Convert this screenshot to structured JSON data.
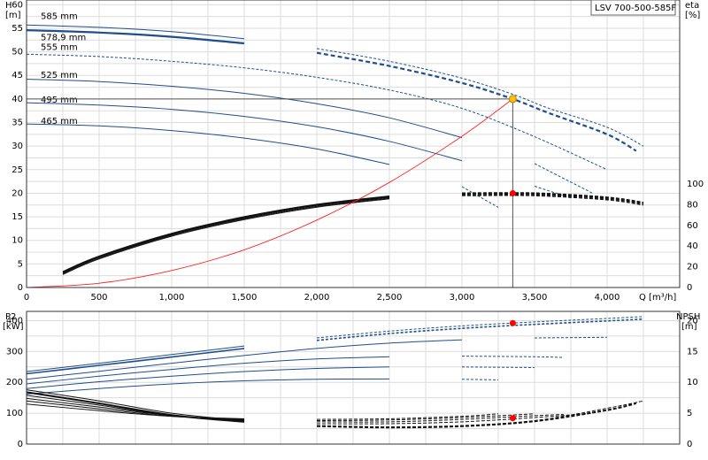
{
  "title": "LSV 700-500-585F",
  "upper": {
    "left_axis_label": "H",
    "left_axis_unit": "[m]",
    "right_axis_label": "eta",
    "right_axis_unit": "[%]",
    "x_label": "Q [m³/h]",
    "y_ticks": [
      "0",
      "5",
      "10",
      "15",
      "20",
      "25",
      "30",
      "35",
      "40",
      "45",
      "50",
      "55",
      "60"
    ],
    "x_ticks": [
      "0",
      "500",
      "1,000",
      "1,500",
      "2,000",
      "2,500",
      "3,000",
      "3,500",
      "4,000"
    ],
    "eta_ticks": [
      "0",
      "20",
      "40",
      "60",
      "80",
      "100"
    ]
  },
  "lower": {
    "left_axis_label": "P2",
    "left_axis_unit": "[kW]",
    "right_axis_label": "NPSH",
    "right_axis_unit": "[m]",
    "p2_ticks": [
      "0",
      "100",
      "200",
      "300",
      "400"
    ],
    "npsh_ticks": [
      "0",
      "5",
      "10",
      "15",
      "20"
    ]
  },
  "colors": {
    "curve": "#1f4e8c",
    "efficiency": "#111111",
    "system": "#ff2020",
    "operating_point": "#ffc000",
    "marker": "#ff0000"
  },
  "chart_data": [
    {
      "type": "line",
      "name": "head",
      "xlim": [
        0,
        4500
      ],
      "ylim": [
        0,
        61
      ],
      "series": [
        {
          "name": "585 mm",
          "label_y": 57.5,
          "x": [
            0,
            500,
            1000,
            1500,
            2000,
            2500,
            3000,
            3350,
            3600,
            4000,
            4250
          ],
          "y": [
            55.7,
            55.2,
            54.3,
            52.8,
            50.7,
            48.0,
            44.4,
            41.0,
            38.0,
            34.0,
            30.0
          ]
        },
        {
          "name": "578,9 mm",
          "label_y": 53.0,
          "x": [
            0,
            500,
            1000,
            1500,
            2000,
            2500,
            3000,
            3350,
            3600,
            4000,
            4200
          ],
          "y": [
            54.6,
            54.1,
            53.2,
            51.8,
            49.8,
            47.0,
            43.4,
            40.0,
            37.0,
            32.5,
            29.0
          ]
        },
        {
          "name": "555 mm",
          "label_y": 51.0,
          "x": [
            0,
            500,
            1000,
            1500,
            2000,
            2500,
            3000,
            3500,
            4000
          ],
          "y": [
            49.5,
            49.0,
            48.0,
            46.6,
            44.6,
            41.9,
            38.0,
            32.0,
            25.0
          ]
        },
        {
          "name": "525 mm",
          "label_y": 45.0,
          "x": [
            0,
            500,
            1000,
            1500,
            2000,
            2500,
            3000,
            3500,
            3900
          ],
          "y": [
            44.2,
            43.7,
            42.7,
            41.2,
            39.0,
            36.0,
            31.8,
            26.3,
            20.0
          ]
        },
        {
          "name": "495 mm",
          "label_y": 39.8,
          "x": [
            0,
            500,
            1000,
            1500,
            2000,
            2500,
            3000,
            3500,
            3750
          ],
          "y": [
            39.2,
            38.7,
            37.8,
            36.3,
            34.1,
            31.0,
            26.9,
            21.5,
            19.0
          ]
        },
        {
          "name": "465 mm",
          "label_y": 35.3,
          "x": [
            0,
            500,
            1000,
            1500,
            2000,
            2500,
            3000,
            3250
          ],
          "y": [
            34.7,
            34.3,
            33.3,
            31.7,
            29.4,
            26.1,
            21.4,
            17.0
          ]
        }
      ],
      "system_curve": {
        "x": [
          0,
          500,
          1000,
          1500,
          2000,
          2500,
          3000,
          3350
        ],
        "y": [
          0,
          0.9,
          3.6,
          8.0,
          14.3,
          22.3,
          32.1,
          40.0
        ]
      },
      "efficiency": {
        "x": [
          250,
          500,
          1000,
          1500,
          2000,
          2500,
          3000,
          3500,
          4000,
          4250
        ],
        "y": [
          15,
          30,
          52,
          68,
          80,
          88,
          91,
          91,
          87,
          82
        ]
      },
      "operating_point": {
        "q": 3350,
        "h": 40.0,
        "eta": 91
      }
    },
    {
      "type": "line",
      "name": "power_npsh",
      "xlim": [
        0,
        4500
      ],
      "p2_lim": [
        0,
        430
      ],
      "npsh_lim": [
        0,
        21.5
      ],
      "p2_series": [
        {
          "name": "585 mm",
          "x": [
            0,
            500,
            1000,
            1500,
            2000,
            2500,
            3000,
            3500,
            4000,
            4250
          ],
          "y": [
            235,
            262,
            290,
            318,
            344,
            366,
            383,
            396,
            407,
            413
          ]
        },
        {
          "name": "578,9 mm",
          "x": [
            0,
            500,
            1000,
            1500,
            2000,
            2500,
            3000,
            3500,
            4000,
            4250
          ],
          "y": [
            228,
            255,
            282,
            310,
            336,
            358,
            375,
            388,
            399,
            405
          ]
        },
        {
          "name": "555 mm",
          "x": [
            0,
            500,
            1000,
            1500,
            2000,
            2500,
            3000,
            3500,
            4000
          ],
          "y": [
            210,
            236,
            262,
            287,
            310,
            327,
            338,
            344,
            346
          ]
        },
        {
          "name": "525 mm",
          "x": [
            0,
            500,
            1000,
            1500,
            2000,
            2500,
            3000,
            3500,
            3700
          ],
          "y": [
            195,
            220,
            242,
            262,
            276,
            283,
            285,
            283,
            281
          ]
        },
        {
          "name": "495 mm",
          "x": [
            0,
            500,
            1000,
            1500,
            2000,
            2500,
            3000,
            3500
          ],
          "y": [
            180,
            202,
            220,
            235,
            245,
            250,
            250,
            248
          ]
        },
        {
          "name": "465 mm",
          "x": [
            0,
            500,
            1000,
            1500,
            2000,
            2500,
            3000,
            3250
          ],
          "y": [
            162,
            180,
            195,
            205,
            210,
            211,
            210,
            208
          ]
        }
      ],
      "npsh_series": [
        {
          "name": "585 mm",
          "x": [
            0,
            500,
            1000,
            1500,
            2000,
            2500,
            3000,
            3500,
            4000,
            4250
          ],
          "y": [
            8.8,
            7.0,
            5.0,
            3.8,
            3.0,
            2.8,
            3.0,
            3.8,
            5.8,
            7.0
          ]
        },
        {
          "name": "578,9 mm",
          "x": [
            0,
            500,
            1000,
            1500,
            2000,
            2500,
            3000,
            3500,
            4000,
            4200
          ],
          "y": [
            8.4,
            6.6,
            4.7,
            3.6,
            2.9,
            2.7,
            2.9,
            3.7,
            5.5,
            6.6
          ]
        },
        {
          "name": "555 mm",
          "x": [
            0,
            500,
            1000,
            1500,
            2000,
            2500,
            3000,
            3500,
            3900
          ],
          "y": [
            7.9,
            6.3,
            4.6,
            3.8,
            3.3,
            3.3,
            3.6,
            4.3,
            5.0
          ]
        },
        {
          "name": "525 mm",
          "x": [
            0,
            500,
            1000,
            1500,
            2000,
            2500,
            3000,
            3500,
            3700
          ],
          "y": [
            7.4,
            6.0,
            4.6,
            3.9,
            3.6,
            3.6,
            4.0,
            4.6,
            4.8
          ]
        },
        {
          "name": "495 mm",
          "x": [
            0,
            500,
            1000,
            1500,
            2000,
            2500,
            3000,
            3500
          ],
          "y": [
            7.0,
            5.7,
            4.5,
            4.0,
            3.8,
            3.9,
            4.3,
            4.9
          ]
        },
        {
          "name": "465 mm",
          "x": [
            0,
            500,
            1000,
            1500,
            2000,
            2500,
            3000,
            3250
          ],
          "y": [
            6.5,
            5.4,
            4.5,
            4.1,
            4.0,
            4.1,
            4.5,
            4.9
          ]
        }
      ],
      "operating_point": {
        "q": 3350,
        "p2": 392,
        "npsh": 4.2
      }
    }
  ]
}
